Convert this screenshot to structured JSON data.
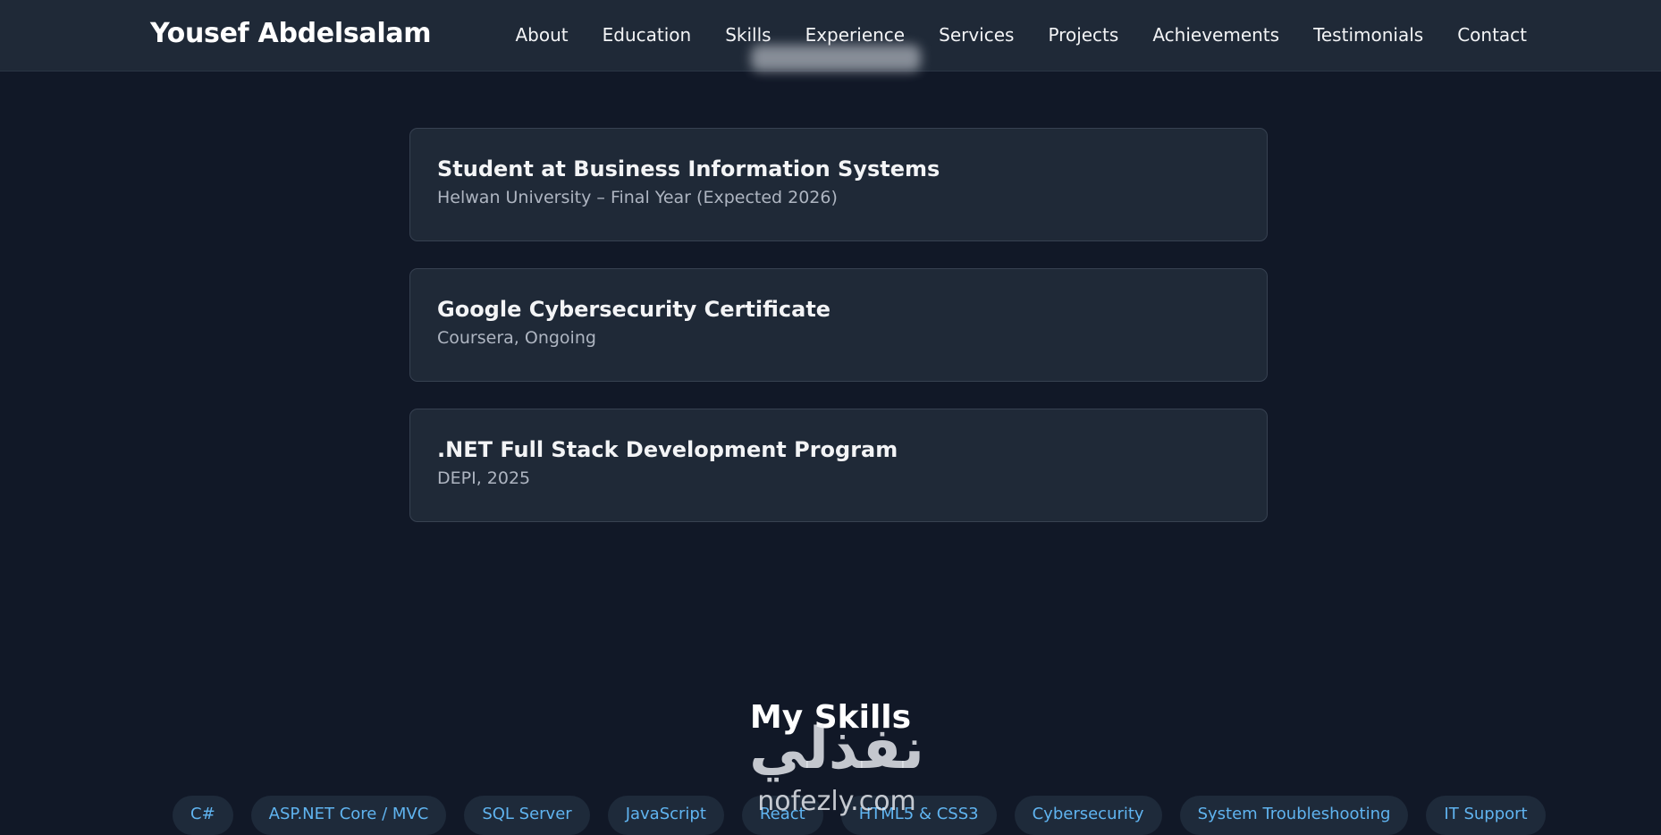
{
  "header": {
    "brand": "Yousef Abdelsalam",
    "nav": [
      "About",
      "Education",
      "Skills",
      "Experience",
      "Services",
      "Projects",
      "Achievements",
      "Testimonials",
      "Contact"
    ]
  },
  "education": [
    {
      "title": "Student at Business Information Systems",
      "subtitle": "Helwan University – Final Year (Expected 2026)"
    },
    {
      "title": "Google Cybersecurity Certificate",
      "subtitle": "Coursera, Ongoing"
    },
    {
      "title": ".NET Full Stack Development Program",
      "subtitle": "DEPI, 2025"
    }
  ],
  "skills": {
    "title": "My Skills",
    "items": [
      "C#",
      "ASP.NET Core / MVC",
      "SQL Server",
      "JavaScript",
      "React",
      "HTML5 & CSS3",
      "Cybersecurity",
      "System Troubleshooting",
      "IT Support"
    ]
  },
  "watermark": {
    "arabic": "نفذلي",
    "latin": "nofezly.com"
  },
  "colors": {
    "background": "#111827",
    "navbar": "#1f2937",
    "card": "#1f2937",
    "accent": "#60b4f0"
  }
}
